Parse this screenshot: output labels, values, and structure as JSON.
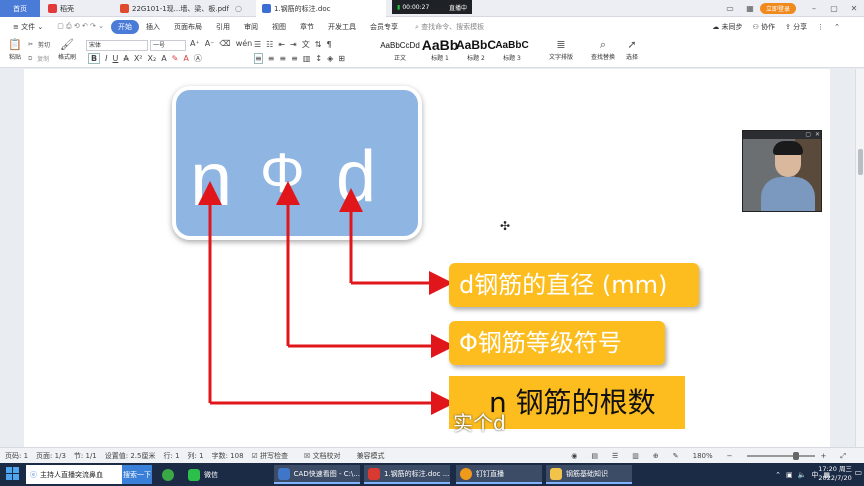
{
  "titlebar": {
    "tabs": [
      {
        "label": "首页"
      },
      {
        "label": "稻壳"
      },
      {
        "label": "22G101-1现...墙、梁、板.pdf"
      },
      {
        "label": "1.钢筋的标注.doc"
      }
    ],
    "live_time": "00:00:27",
    "live_label": "直播中",
    "login": "立即登录"
  },
  "menubar": {
    "file": "文件",
    "items": [
      "开始",
      "插入",
      "页面布局",
      "引用",
      "审阅",
      "视图",
      "章节",
      "开发工具",
      "会员专享"
    ],
    "search_placeholder": "查找命令、搜索模板",
    "right": [
      "未同步",
      "协作",
      "分享"
    ]
  },
  "ribbon": {
    "paste": "粘贴",
    "cut": "剪切",
    "copy": "复制",
    "format_painter": "格式刷",
    "font_name": "宋体",
    "font_size": "一号",
    "styles": [
      {
        "sample": "AaBbCcDd",
        "name": "正文"
      },
      {
        "sample": "AaBb",
        "name": "标题 1"
      },
      {
        "sample": "AaBbC",
        "name": "标题 2"
      },
      {
        "sample": "AaBbC",
        "name": "标题 3"
      }
    ],
    "text_layout": "文字排版",
    "find_replace": "查找替换",
    "select": "选择"
  },
  "document": {
    "symbol_n": "n",
    "symbol_phi": "Φ",
    "symbol_d": "d",
    "label_d": "d钢筋的直径 (mm)",
    "label_phi": "Φ钢筋等级符号",
    "label_n": "n 钢筋的根数",
    "caption": "实个d",
    "colors": {
      "box": "#8fb5e3",
      "label": "#fdbd1f",
      "arrow": "#e0161b"
    }
  },
  "statusbar": {
    "page_no": "页码: 1",
    "page": "页面: 1/3",
    "section": "节: 1/1",
    "setting": "设置值: 2.5厘米",
    "row": "行: 1",
    "col": "列: 1",
    "words": "字数: 108",
    "spell": "拼写检查",
    "proof": "文档校对",
    "compat": "兼容模式",
    "zoom": "180%"
  },
  "taskbar": {
    "search_text": "主持人直播突流鼻血",
    "search_button": "搜索一下",
    "apps": [
      {
        "label": "微信"
      },
      {
        "label": "CAD快速看图 - C:\\..."
      },
      {
        "label": "1.钢筋的标注.doc ..."
      },
      {
        "label": "钉钉直播"
      },
      {
        "label": "钢筋基础知识"
      }
    ],
    "ime": "中",
    "time": "17:20 周三",
    "date": "2022/7/20"
  }
}
